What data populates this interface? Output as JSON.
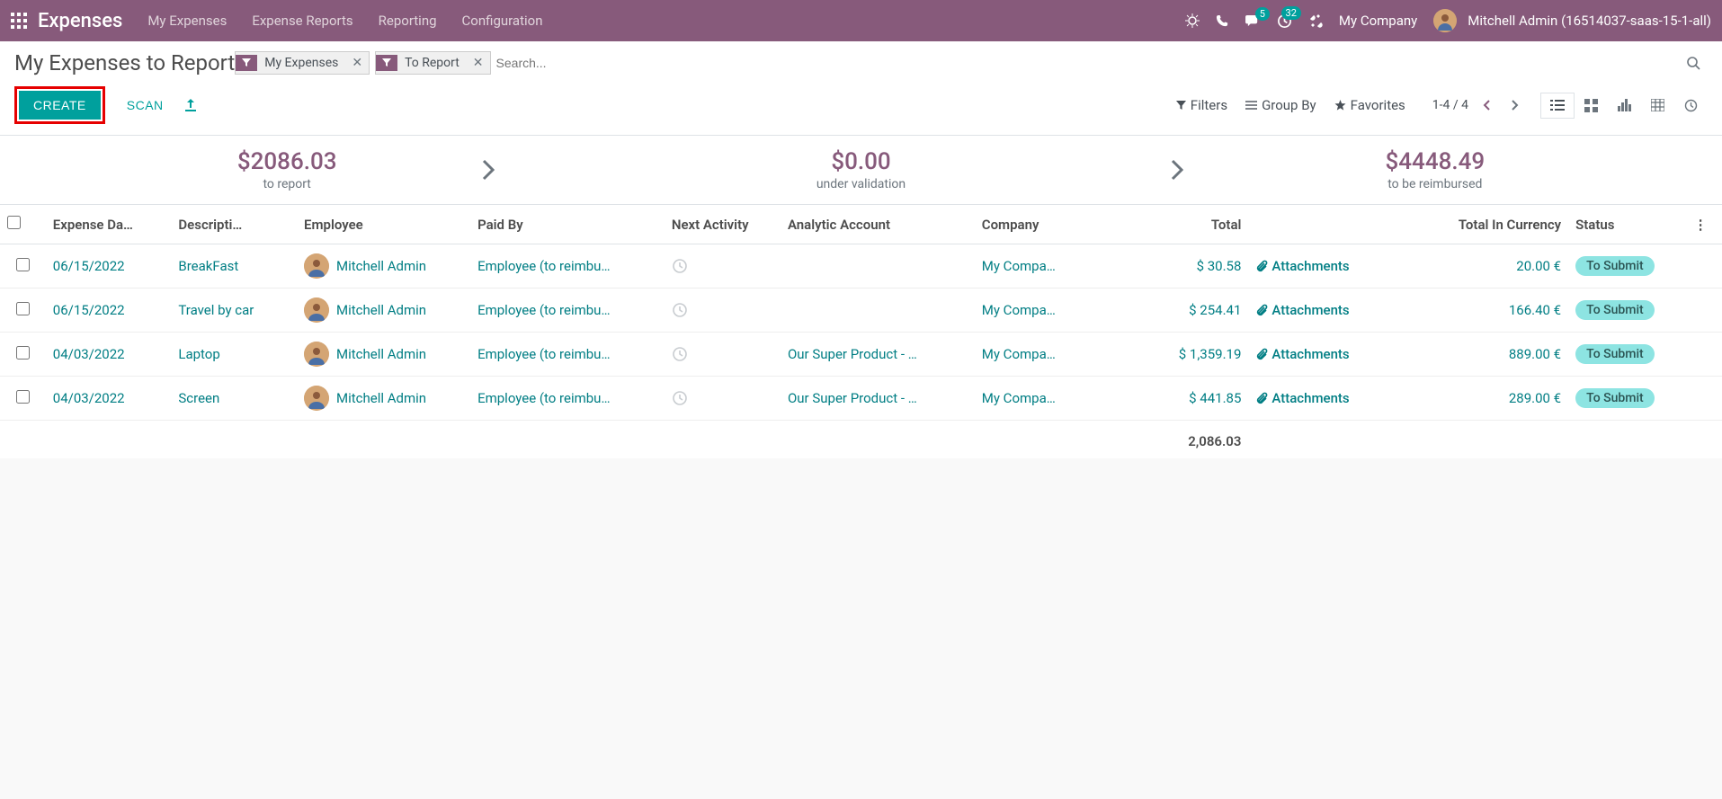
{
  "navbar": {
    "brand": "Expenses",
    "links": [
      "My Expenses",
      "Expense Reports",
      "Reporting",
      "Configuration"
    ],
    "messaging_badge": "5",
    "activity_badge": "32",
    "company": "My Company",
    "user": "Mitchell Admin (16514037-saas-15-1-all)"
  },
  "breadcrumb": "My Expenses to Report",
  "facets": [
    {
      "label": "My Expenses"
    },
    {
      "label": "To Report"
    }
  ],
  "search_placeholder": "Search...",
  "buttons": {
    "create": "CREATE",
    "scan": "SCAN"
  },
  "search_options": {
    "filters": "Filters",
    "group_by": "Group By",
    "favorites": "Favorites"
  },
  "pager": "1-4 / 4",
  "summary": [
    {
      "amount": "$2086.03",
      "label": "to report"
    },
    {
      "amount": "$0.00",
      "label": "under validation"
    },
    {
      "amount": "$4448.49",
      "label": "to be reimbursed"
    }
  ],
  "columns": {
    "date": "Expense Da…",
    "description": "Descripti…",
    "employee": "Employee",
    "paid_by": "Paid By",
    "next_activity": "Next Activity",
    "analytic": "Analytic Account",
    "company": "Company",
    "total": "Total",
    "total_currency": "Total In Currency",
    "status": "Status"
  },
  "attachments_label": "Attachments",
  "rows": [
    {
      "date": "06/15/2022",
      "description": "BreakFast",
      "employee": "Mitchell Admin",
      "paid_by": "Employee (to reimbu…",
      "analytic": "",
      "company": "My Compa…",
      "total": "$ 30.58",
      "total_currency": "20.00 €",
      "status": "To Submit"
    },
    {
      "date": "06/15/2022",
      "description": "Travel by car",
      "employee": "Mitchell Admin",
      "paid_by": "Employee (to reimbu…",
      "analytic": "",
      "company": "My Compa…",
      "total": "$ 254.41",
      "total_currency": "166.40 €",
      "status": "To Submit"
    },
    {
      "date": "04/03/2022",
      "description": "Laptop",
      "employee": "Mitchell Admin",
      "paid_by": "Employee (to reimbu…",
      "analytic": "Our Super Product - …",
      "company": "My Compa…",
      "total": "$ 1,359.19",
      "total_currency": "889.00 €",
      "status": "To Submit"
    },
    {
      "date": "04/03/2022",
      "description": "Screen",
      "employee": "Mitchell Admin",
      "paid_by": "Employee (to reimbu…",
      "analytic": "Our Super Product - …",
      "company": "My Compa…",
      "total": "$ 441.85",
      "total_currency": "289.00 €",
      "status": "To Submit"
    }
  ],
  "grand_total": "2,086.03"
}
